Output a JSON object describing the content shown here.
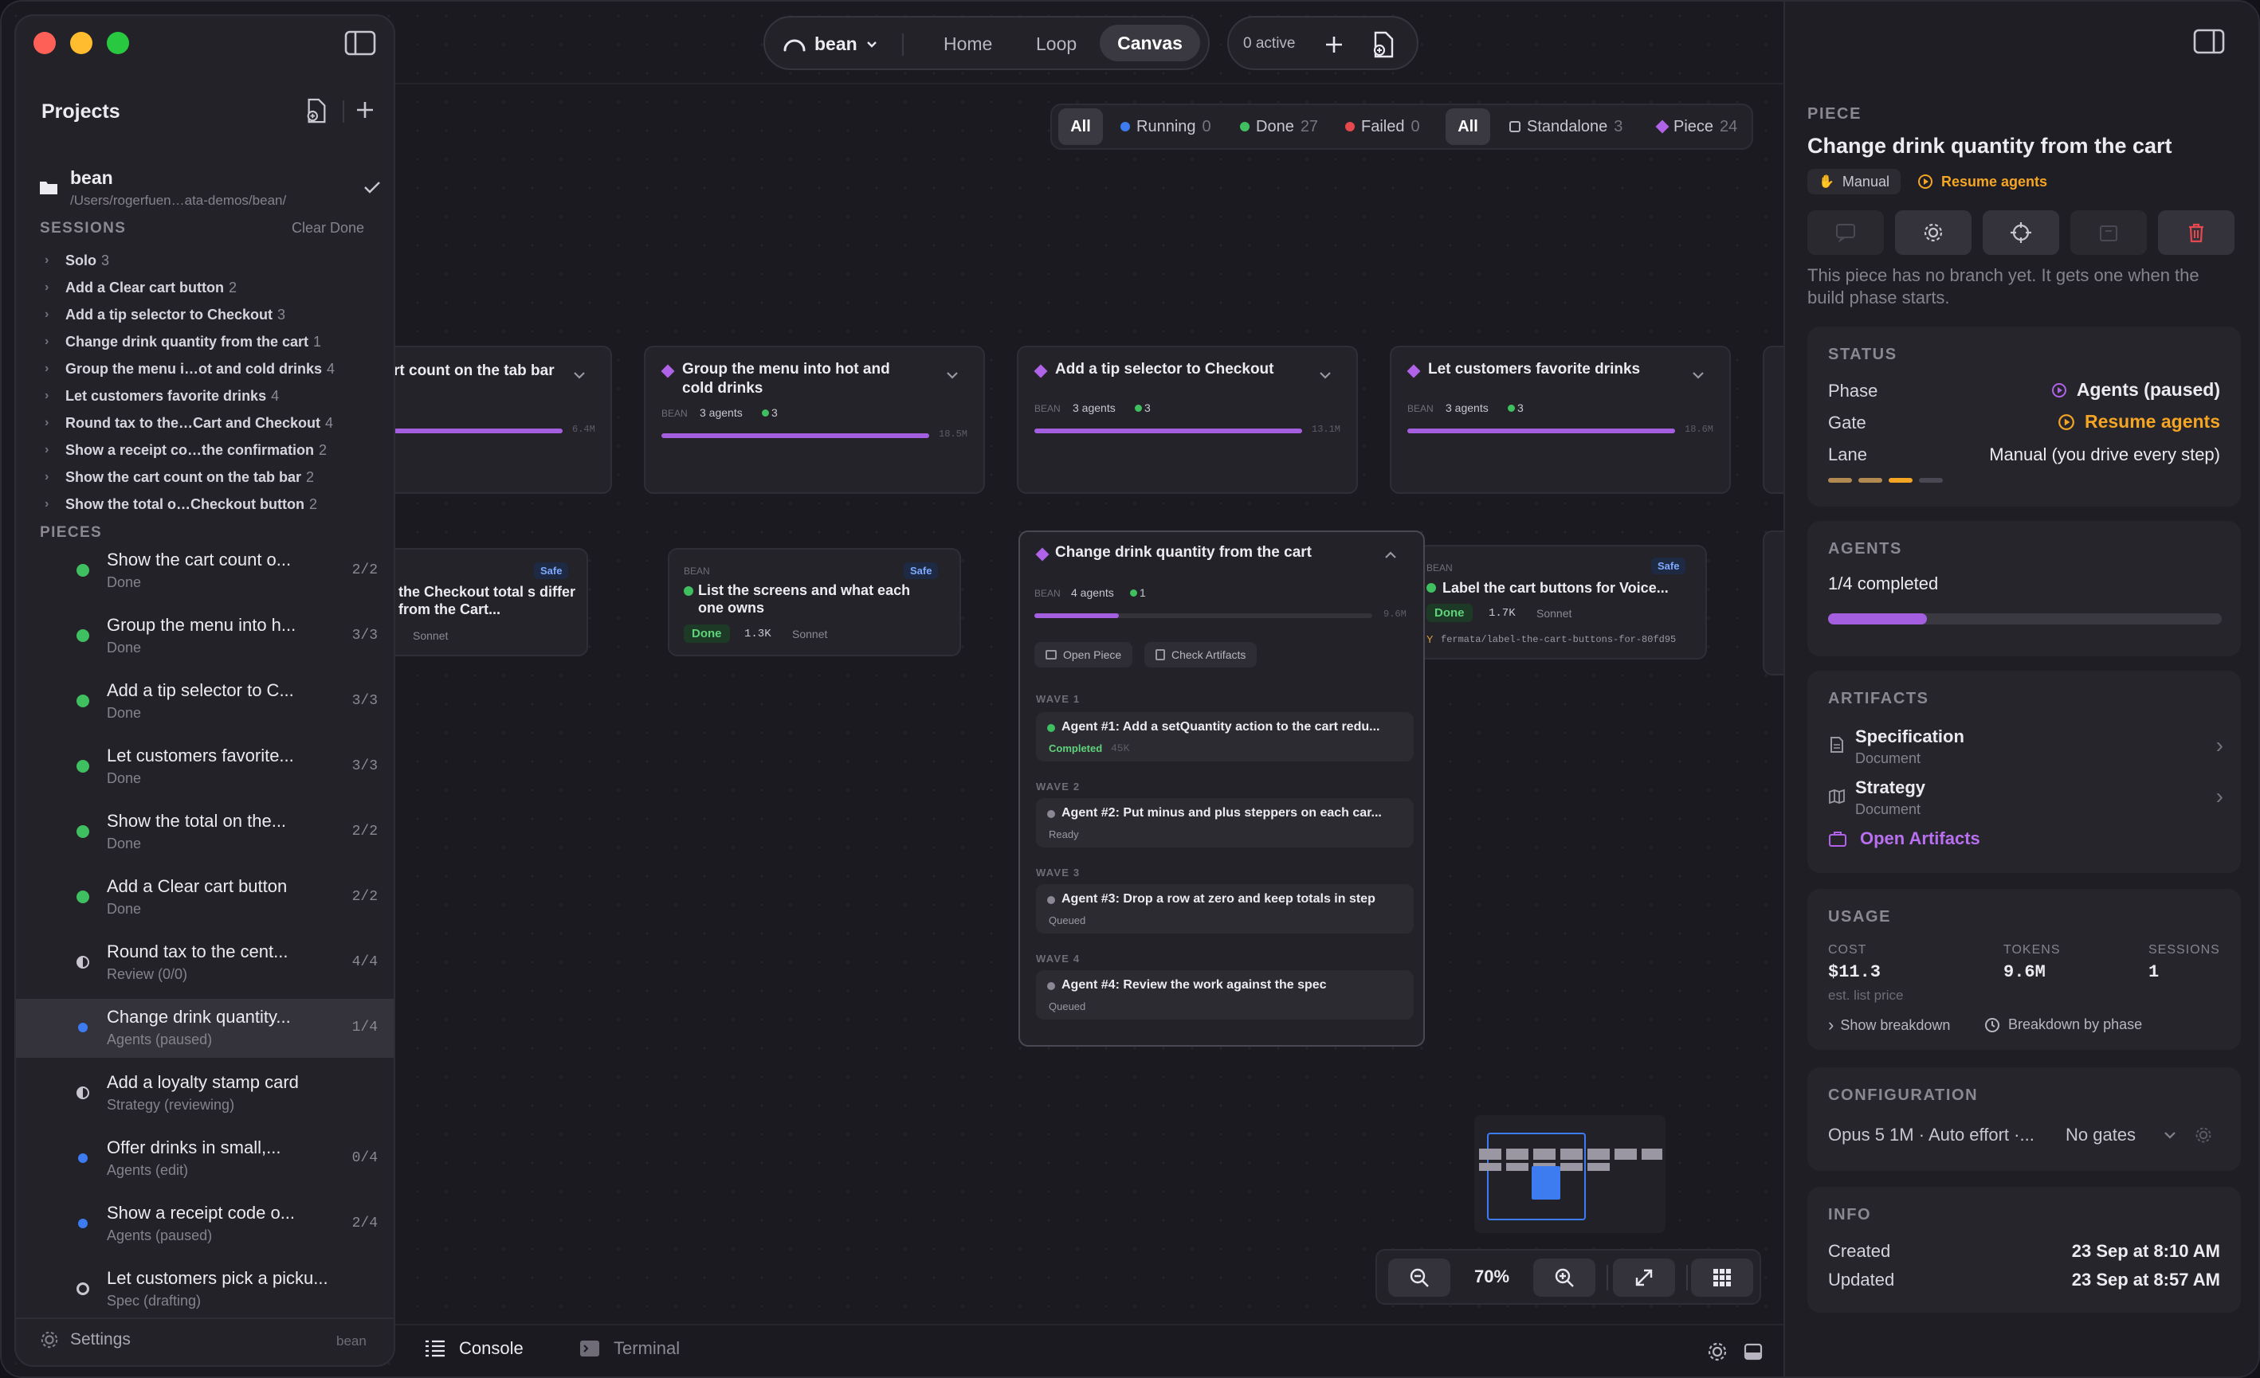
{
  "app": {
    "project": "bean",
    "nav": [
      "Home",
      "Loop",
      "Canvas"
    ],
    "nav_active": "Canvas",
    "active_label": "0 active"
  },
  "sidebar": {
    "title": "Projects",
    "project_name": "bean",
    "project_path": "/Users/rogerfuen…ata-demos/bean/",
    "sessions_header": "SESSIONS",
    "clear_done": "Clear Done",
    "sessions": [
      {
        "label": "Solo",
        "count": "3"
      },
      {
        "label": "Add a Clear cart button",
        "count": "2"
      },
      {
        "label": "Add a tip selector to Checkout",
        "count": "3"
      },
      {
        "label": "Change drink quantity from the cart",
        "count": "1"
      },
      {
        "label": "Group the menu i…ot and cold drinks",
        "count": "4"
      },
      {
        "label": "Let customers favorite drinks",
        "count": "4"
      },
      {
        "label": "Round tax to the…Cart and Checkout",
        "count": "4"
      },
      {
        "label": "Show a receipt co…the confirmation",
        "count": "2"
      },
      {
        "label": "Show the cart count on the tab bar",
        "count": "2"
      },
      {
        "label": "Show the total o…Checkout button",
        "count": "2"
      }
    ],
    "pieces_header": "PIECES",
    "pieces": [
      {
        "title": "Show the cart count o...",
        "status": "Done",
        "progress": "2/2",
        "dot": "#3fbf5f"
      },
      {
        "title": "Group the menu into h...",
        "status": "Done",
        "progress": "3/3",
        "dot": "#3fbf5f"
      },
      {
        "title": "Add a tip selector to C...",
        "status": "Done",
        "progress": "3/3",
        "dot": "#3fbf5f"
      },
      {
        "title": "Let customers favorite...",
        "status": "Done",
        "progress": "3/3",
        "dot": "#3fbf5f"
      },
      {
        "title": "Show the total on the...",
        "status": "Done",
        "progress": "2/2",
        "dot": "#3fbf5f"
      },
      {
        "title": "Add a Clear cart button",
        "status": "Done",
        "progress": "2/2",
        "dot": "#3fbf5f"
      },
      {
        "title": "Round tax to the cent...",
        "status": "Review (0/0)",
        "progress": "4/4",
        "dot": "half"
      },
      {
        "title": "Change drink quantity...",
        "status": "Agents (paused)",
        "progress": "1/4",
        "dot": "#3d7bf0"
      },
      {
        "title": "Add a loyalty stamp card",
        "status": "Strategy (reviewing)",
        "progress": "",
        "dot": "half"
      },
      {
        "title": "Offer drinks in small,...",
        "status": "Agents (edit)",
        "progress": "0/4",
        "dot": "#3d7bf0"
      },
      {
        "title": "Show a receipt code o...",
        "status": "Agents (paused)",
        "progress": "2/4",
        "dot": "#3d7bf0"
      },
      {
        "title": "Let customers pick a picku...",
        "status": "Spec (drafting)",
        "progress": "",
        "dot": "ring"
      }
    ],
    "settings": "Settings",
    "settings_project": "bean"
  },
  "filters": {
    "all1": "All",
    "running": "Running",
    "running_count": "0",
    "done": "Done",
    "done_count": "27",
    "failed": "Failed",
    "failed_count": "0",
    "all2": "All",
    "standalone": "Standalone",
    "standalone_count": "3",
    "piece": "Piece",
    "piece_count": "24"
  },
  "cards": {
    "c1": {
      "title": "rt count on the tab bar",
      "tokens": "6.4M"
    },
    "c2": {
      "title": "Group the menu into hot and cold drinks",
      "tag": "BEAN",
      "agents": "3 agents",
      "ok": "3",
      "tokens": "18.5M"
    },
    "c3": {
      "title": "Add a tip selector to Checkout",
      "tag": "BEAN",
      "agents": "3 agents",
      "ok": "3",
      "tokens": "13.1M"
    },
    "c4": {
      "title": "Let customers favorite drinks",
      "tag": "BEAN",
      "agents": "3 agents",
      "ok": "3",
      "tokens": "18.6M"
    },
    "s1": {
      "title": "the Checkout total s differ from the Cart...",
      "safe": "Safe",
      "model": "Sonnet"
    },
    "s2": {
      "tag": "BEAN",
      "title": "List the screens and what each one owns",
      "safe": "Safe",
      "status": "Done",
      "tokens": "1.3K",
      "model": "Sonnet"
    },
    "s3": {
      "tag": "BEAN",
      "title": "Label the cart buttons for Voice...",
      "safe": "Safe",
      "status": "Done",
      "tokens": "1.7K",
      "model": "Sonnet",
      "branch": "fermata/label-the-cart-buttons-for-80fd95"
    },
    "main": {
      "title": "Change drink quantity from the cart",
      "tag": "BEAN",
      "agents": "4 agents",
      "ok": "1",
      "tokens": "9.6M",
      "open_piece": "Open Piece",
      "check_artifacts": "Check Artifacts",
      "waves": [
        {
          "label": "WAVE 1",
          "agent": "Agent #1: Add a setQuantity action to the cart redu...",
          "status": "Completed",
          "extra": "45K",
          "dot": "#3fbf5f"
        },
        {
          "label": "WAVE 2",
          "agent": "Agent #2: Put minus and plus steppers on each car...",
          "status": "Ready",
          "extra": "",
          "dot": "#8b8893"
        },
        {
          "label": "WAVE 3",
          "agent": "Agent #3: Drop a row at zero and keep totals in step",
          "status": "Queued",
          "extra": "",
          "dot": "#8b8893"
        },
        {
          "label": "WAVE 4",
          "agent": "Agent #4: Review the work against the spec",
          "status": "Queued",
          "extra": "",
          "dot": "#8b8893"
        }
      ]
    }
  },
  "zoom": {
    "level": "70%"
  },
  "bottom": {
    "console": "Console",
    "terminal": "Terminal"
  },
  "panel": {
    "header": "PIECE",
    "title": "Change drink quantity from the cart",
    "mode": "Manual",
    "resume": "Resume agents",
    "note": "This piece has no branch yet. It gets one when the build phase starts.",
    "status": {
      "header": "STATUS",
      "phase_label": "Phase",
      "phase_value": "Agents (paused)",
      "gate_label": "Gate",
      "gate_value": "Resume agents",
      "lane_label": "Lane",
      "lane_value": "Manual (you drive every step)"
    },
    "agents": {
      "header": "AGENTS",
      "completed": "1/4 completed",
      "progress": 0.25
    },
    "artifacts": {
      "header": "ARTIFACTS",
      "items": [
        {
          "title": "Specification",
          "type": "Document"
        },
        {
          "title": "Strategy",
          "type": "Document"
        }
      ],
      "open": "Open Artifacts"
    },
    "usage": {
      "header": "USAGE",
      "cost_label": "COST",
      "cost": "$11.3",
      "cost_note": "est. list price",
      "tokens_label": "TOKENS",
      "tokens": "9.6M",
      "sessions_label": "SESSIONS",
      "sessions": "1",
      "show_breakdown": "Show breakdown",
      "by_phase": "Breakdown by phase"
    },
    "config": {
      "header": "CONFIGURATION",
      "model": "Opus 5 1M · Auto effort ·...",
      "gates": "No gates"
    },
    "info": {
      "header": "INFO",
      "created_label": "Created",
      "created": "23 Sep at 8:10 AM",
      "updated_label": "Updated",
      "updated": "23 Sep at 8:57 AM"
    }
  },
  "colors": {
    "accent": "#a35fe0",
    "green": "#3fbf5f",
    "blue": "#3d7bf0",
    "orange": "#f5a524",
    "red": "#e5484d"
  }
}
